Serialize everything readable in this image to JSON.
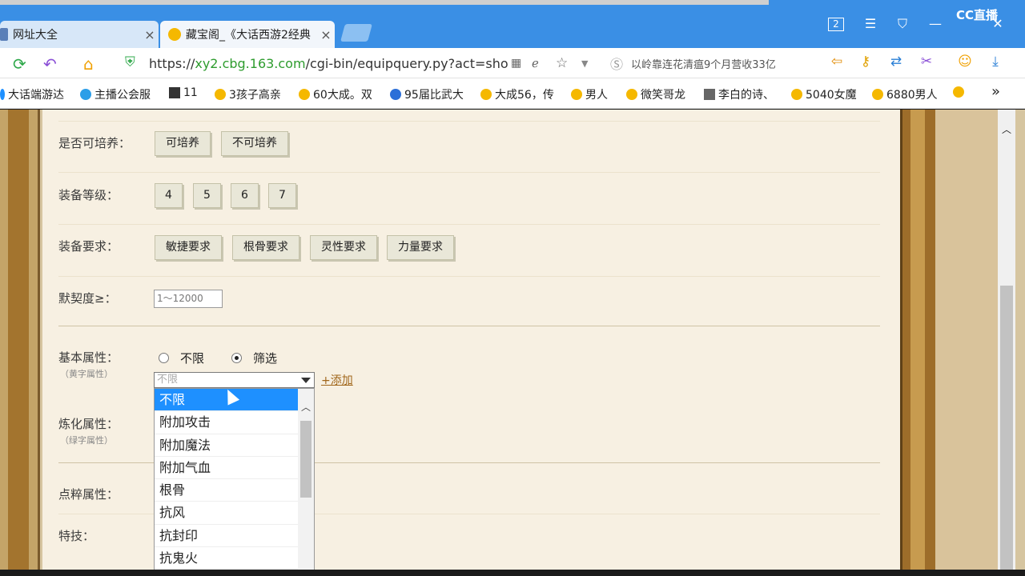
{
  "tabs": [
    {
      "label": "网址大全",
      "close": "×"
    },
    {
      "label": "藏宝阁_《大话西游2经典",
      "close": "×"
    }
  ],
  "watermark": "CC直播",
  "window_badge": "2",
  "address": {
    "scheme": "https://",
    "host": "xy2.cbg.163.com",
    "path": "/cgi-bin/equipquery.py?act=sho"
  },
  "search": {
    "text": "以岭靠连花清瘟9个月营收33亿"
  },
  "bookmarks": [
    {
      "label": "大话端游达",
      "color": "#1e90ff"
    },
    {
      "label": "主播公会服",
      "color": "#2b9ee8"
    },
    {
      "label": "11",
      "color": "#333333"
    },
    {
      "label": "3孩子高亲",
      "color": "#f5b800"
    },
    {
      "label": "60大成。双",
      "color": "#f5b800"
    },
    {
      "label": "95届比武大",
      "color": "#2b6fd8"
    },
    {
      "label": "大成56，传",
      "color": "#f5b800"
    },
    {
      "label": "男人",
      "color": "#f5b800"
    },
    {
      "label": "微笑哥龙",
      "color": "#f5b800"
    },
    {
      "label": "李白的诗、",
      "color": "#666666"
    },
    {
      "label": "5040女魔",
      "color": "#f5b800"
    },
    {
      "label": "6880男人",
      "color": "#f5b800"
    }
  ],
  "bookmarks_more": "»",
  "form": {
    "cultivable": {
      "label": "是否可培养：",
      "options": [
        "可培养",
        "不可培养"
      ]
    },
    "level": {
      "label": "装备等级：",
      "options": [
        "4",
        "5",
        "6",
        "7"
      ]
    },
    "requirement": {
      "label": "装备要求：",
      "options": [
        "敏捷要求",
        "根骨要求",
        "灵性要求",
        "力量要求"
      ]
    },
    "tacit": {
      "label": "默契度≥：",
      "placeholder": "1～12000"
    },
    "basic_attr": {
      "label": "基本属性：",
      "sublabel": "（黄字属性）",
      "radio_any": "不限",
      "radio_filter": "筛选",
      "select_value": "不限",
      "add": "+添加"
    },
    "refine_attr": {
      "label": "炼化属性：",
      "sublabel": "（绿字属性）"
    },
    "dot_attr": {
      "label": "点粹属性："
    },
    "skill": {
      "label": "特技："
    }
  },
  "dropdown": [
    "不限",
    "附加攻击",
    "附加魔法",
    "附加气血",
    "根骨",
    "抗风",
    "抗封印",
    "抗鬼火"
  ]
}
